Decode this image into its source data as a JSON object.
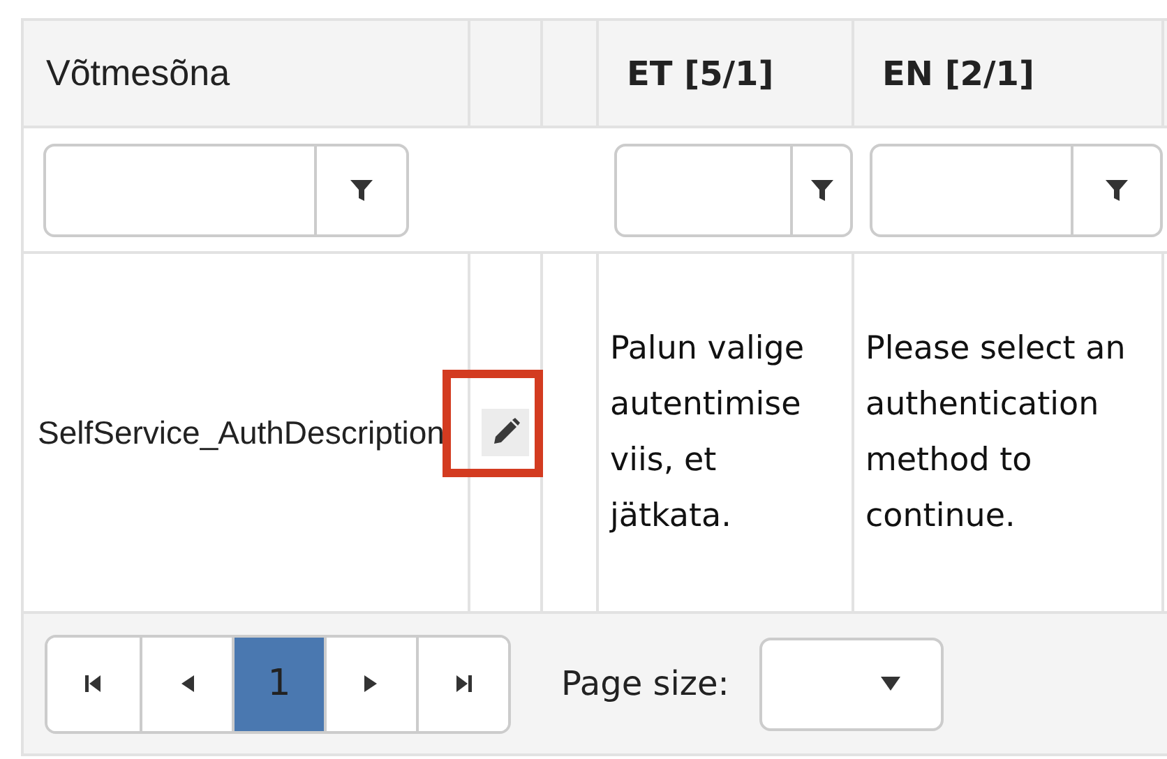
{
  "columns": [
    {
      "kind": "key",
      "label": "Võtmesõna",
      "filter": true
    },
    {
      "kind": "action"
    },
    {
      "kind": "blank"
    },
    {
      "kind": "language",
      "label": "ET [5/1]",
      "filter": true
    },
    {
      "kind": "language",
      "label": "EN [2/1]",
      "filter": true
    }
  ],
  "rows": [
    {
      "key": "SelfService_AuthDescription",
      "editable": true,
      "highlighted": true,
      "translations": [
        "Palun valige autentimise viis, et jätkata.",
        "Please select an authentication method to continue."
      ]
    }
  ],
  "pager": {
    "pages": [
      {
        "label": "1",
        "selected": true
      }
    ],
    "page_size_label": "Page size:"
  }
}
